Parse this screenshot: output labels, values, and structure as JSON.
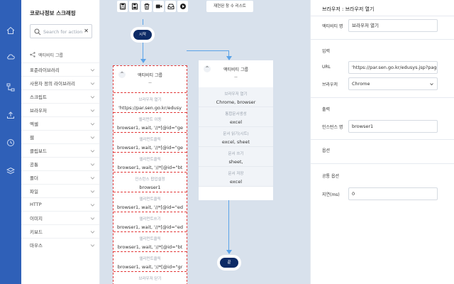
{
  "rail": {
    "icons": [
      "home-icon",
      "cloud-icon",
      "flow-icon",
      "upload-icon",
      "history-icon",
      "layers-icon"
    ]
  },
  "library": {
    "title": "코로나정보 스크래핑",
    "search_placeholder": "Search for action",
    "search_clear": "✕",
    "group_label": "액티비티 그룹",
    "categories": [
      "표준라이브러리",
      "사용자 정의 라이브러리",
      "스크립트",
      "브라우저",
      "엑셀",
      "웹",
      "클립보드",
      "공통",
      "폴더",
      "파일",
      "HTTP",
      "이미지",
      "키보드",
      "마우스"
    ]
  },
  "toolbar": {
    "buttons": [
      "open-file-icon",
      "save-icon",
      "delete-icon",
      "record-icon",
      "inbox-icon",
      "run-icon"
    ],
    "list_label": "재현된 창 수 리스트"
  },
  "flow": {
    "start_label": "시작",
    "end_label": "끝",
    "group1": {
      "title": "액티비티 그룹",
      "subtitle": "--",
      "steps": [
        {
          "title": "브라우저 열기",
          "value": "'https://par.sen.go.kr/edusy"
        },
        {
          "title": "엘리먼트 이동",
          "value": "browser1, wait, '//*[@id=\"ge"
        },
        {
          "title": "엘리먼트클릭",
          "value": "browser1, wait, '//*[@id=\"ge"
        },
        {
          "title": "엘리먼트클릭",
          "value": "browser1, wait, '//*[@id=\"bt"
        },
        {
          "title": "인스턴스 팝업설정",
          "value": "browser1"
        },
        {
          "title": "엘리먼트클릭",
          "value": "browser1, wait, '//*[@id=\"ed"
        },
        {
          "title": "엘리먼트쓰기",
          "value": "browser1, wait, '//*[@id=\"ed"
        },
        {
          "title": "엘리먼트클릭",
          "value": "browser1, wait, '//*[@id=\"bt"
        },
        {
          "title": "엘리먼트클릭",
          "value": "browser1, wait, '//*[@id=\"gr"
        },
        {
          "title": "브라우저 닫기",
          "value": ""
        }
      ]
    },
    "group2": {
      "title": "액티비티 그룹",
      "subtitle": "--",
      "steps": [
        {
          "title": "브라우저 열기",
          "value": "Chrome, browser"
        },
        {
          "title": "통합문서생성",
          "value": "excel"
        },
        {
          "title": "문서 읽기(시트)",
          "value": "excel, sheet"
        },
        {
          "title": "문서 쓰기",
          "value": "sheet,"
        },
        {
          "title": "문서 저장",
          "value": "excel"
        }
      ]
    }
  },
  "properties": {
    "title": "브라우저 : 브라우저 열기",
    "activity_name_label": "액티비티 명",
    "activity_name_value": "브라우저 열기",
    "input_section": "입력",
    "url_label": "URL",
    "url_value": "'https://par.sen.go.kr/edusys.jsp?page=sp",
    "browser_label": "브라우저",
    "browser_value": "Chrome",
    "output_section": "출력",
    "instance_label": "인스턴스 명",
    "instance_value": "browser1",
    "options_section": "옵션",
    "common_options_section": "공통 옵션",
    "delay_label": "지연(ms)",
    "delay_value": "0"
  },
  "colors": {
    "rail": "#2f60b8",
    "connector": "#5ba3e8",
    "pill": "#0d2b66",
    "dashed_border": "#e23a3a"
  }
}
